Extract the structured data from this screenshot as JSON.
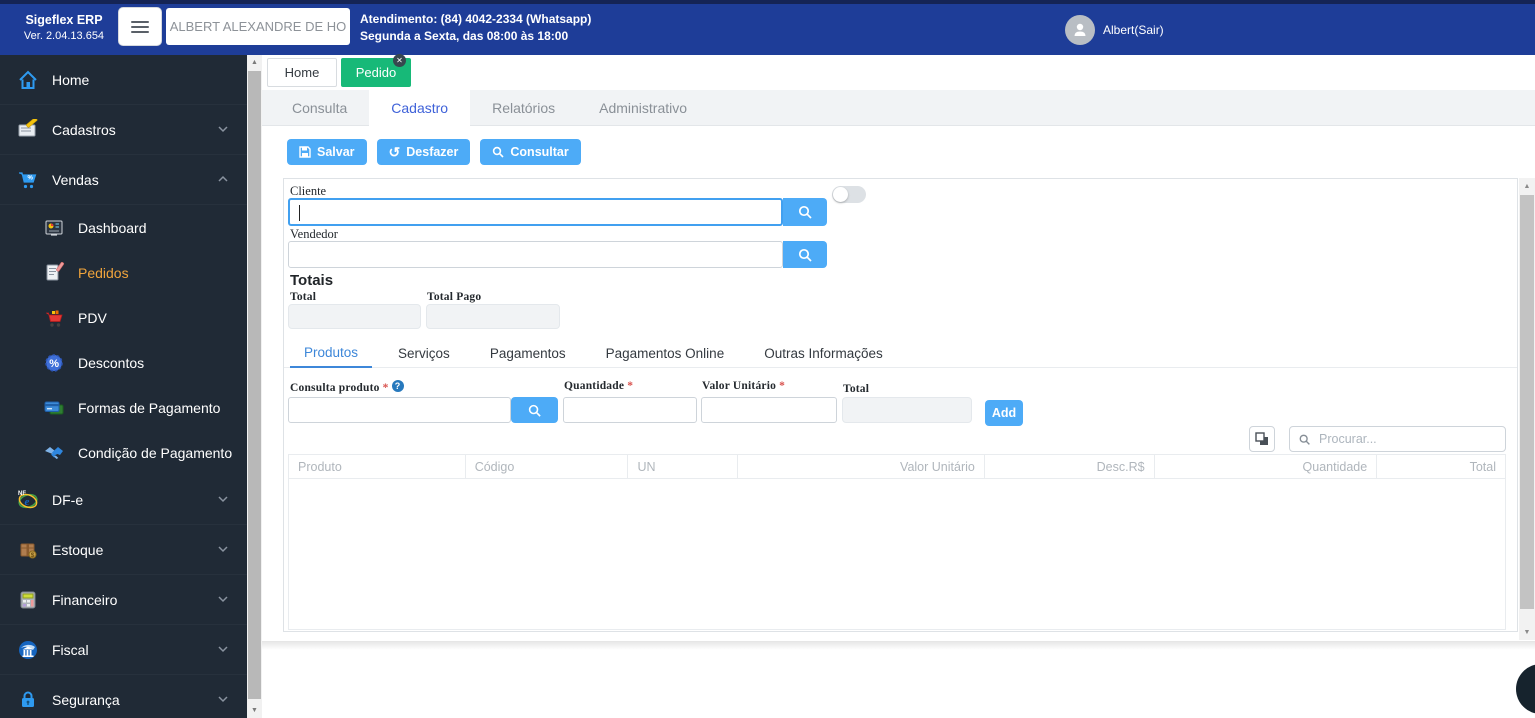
{
  "colors": {
    "header_blue": "#1e3d98",
    "sidebar_dark": "#202a36",
    "accent_blue": "#4dabf7",
    "workspace_tab_green": "#17b978",
    "active_item_orange": "#f0a43c",
    "active_module_tab_blue": "#3f62d9",
    "active_detail_tab_blue": "#3d87d9"
  },
  "header": {
    "brand_name": "Sigeflex ERP",
    "brand_version": "Ver. 2.04.13.654",
    "user_combo_value": "ALBERT ALEXANDRE DE HO",
    "support_line1": "Atendimento: (84) 4042-2334 (Whatsapp)",
    "support_line2": "Segunda a Sexta, das 08:00 às 18:00",
    "user_label": "Albert(Sair)"
  },
  "sidebar": {
    "items": [
      {
        "label": "Home",
        "icon": "home-icon",
        "level": "top",
        "chevron": "none",
        "active": false
      },
      {
        "label": "Cadastros",
        "icon": "cadastros-icon",
        "level": "top",
        "chevron": "down",
        "active": false
      },
      {
        "label": "Vendas",
        "icon": "vendas-icon",
        "level": "top",
        "chevron": "up",
        "active": false
      },
      {
        "label": "Dashboard",
        "icon": "dashboard-icon",
        "level": "sub",
        "chevron": "none",
        "active": false
      },
      {
        "label": "Pedidos",
        "icon": "pedidos-icon",
        "level": "sub",
        "chevron": "none",
        "active": true
      },
      {
        "label": "PDV",
        "icon": "pdv-icon",
        "level": "sub",
        "chevron": "none",
        "active": false
      },
      {
        "label": "Descontos",
        "icon": "descontos-icon",
        "level": "sub",
        "chevron": "none",
        "active": false
      },
      {
        "label": "Formas de Pagamento",
        "icon": "formas-pagamento-icon",
        "level": "sub",
        "chevron": "none",
        "active": false
      },
      {
        "label": "Condição de Pagamento",
        "icon": "condicao-pagamento-icon",
        "level": "sub",
        "chevron": "none",
        "active": false
      },
      {
        "label": "DF-e",
        "icon": "dfe-icon",
        "level": "top",
        "chevron": "down",
        "active": false
      },
      {
        "label": "Estoque",
        "icon": "estoque-icon",
        "level": "top",
        "chevron": "down",
        "active": false
      },
      {
        "label": "Financeiro",
        "icon": "financeiro-icon",
        "level": "top",
        "chevron": "down",
        "active": false
      },
      {
        "label": "Fiscal",
        "icon": "fiscal-icon",
        "level": "top",
        "chevron": "down",
        "active": false
      },
      {
        "label": "Segurança",
        "icon": "seguranca-icon",
        "level": "top",
        "chevron": "down",
        "active": false
      }
    ]
  },
  "workspace_tabs": {
    "home_label": "Home",
    "pedido_label": "Pedido",
    "pedido_close_glyph": "✕"
  },
  "module_tabs": {
    "active": "Cadastro",
    "items": [
      {
        "label": "Consulta"
      },
      {
        "label": "Cadastro"
      },
      {
        "label": "Relatórios"
      },
      {
        "label": "Administrativo"
      }
    ]
  },
  "toolbar": {
    "salvar_label": "Salvar",
    "desfazer_label": "Desfazer",
    "consultar_label": "Consultar",
    "desfazer_icon_glyph": "↺"
  },
  "order_form": {
    "cliente_label": "Cliente",
    "cliente_value": "",
    "vendedor_label": "Vendedor",
    "vendedor_value": "",
    "totais_heading": "Totais",
    "total_label": "Total",
    "total_value": "",
    "total_pago_label": "Total Pago",
    "total_pago_value": ""
  },
  "detail_tabs": {
    "active": "Produtos",
    "items": [
      {
        "label": "Produtos"
      },
      {
        "label": "Serviços"
      },
      {
        "label": "Pagamentos"
      },
      {
        "label": "Pagamentos Online"
      },
      {
        "label": "Outras Informações"
      }
    ]
  },
  "product_entry": {
    "consulta_produto_label": "Consulta produto",
    "required_mark": "*",
    "help_glyph": "?",
    "quantidade_label": "Quantidade",
    "valor_unitario_label": "Valor Unitário",
    "total_label": "Total",
    "add_button_label": "Add"
  },
  "products_table": {
    "search_placeholder": "Procurar...",
    "columns": [
      {
        "label": "Produto",
        "align": "left"
      },
      {
        "label": "Código",
        "align": "left"
      },
      {
        "label": "UN",
        "align": "left"
      },
      {
        "label": "Valor Unitário",
        "align": "right"
      },
      {
        "label": "Desc.R$",
        "align": "right"
      },
      {
        "label": "Quantidade",
        "align": "right"
      },
      {
        "label": "Total",
        "align": "right"
      }
    ],
    "rows": []
  }
}
